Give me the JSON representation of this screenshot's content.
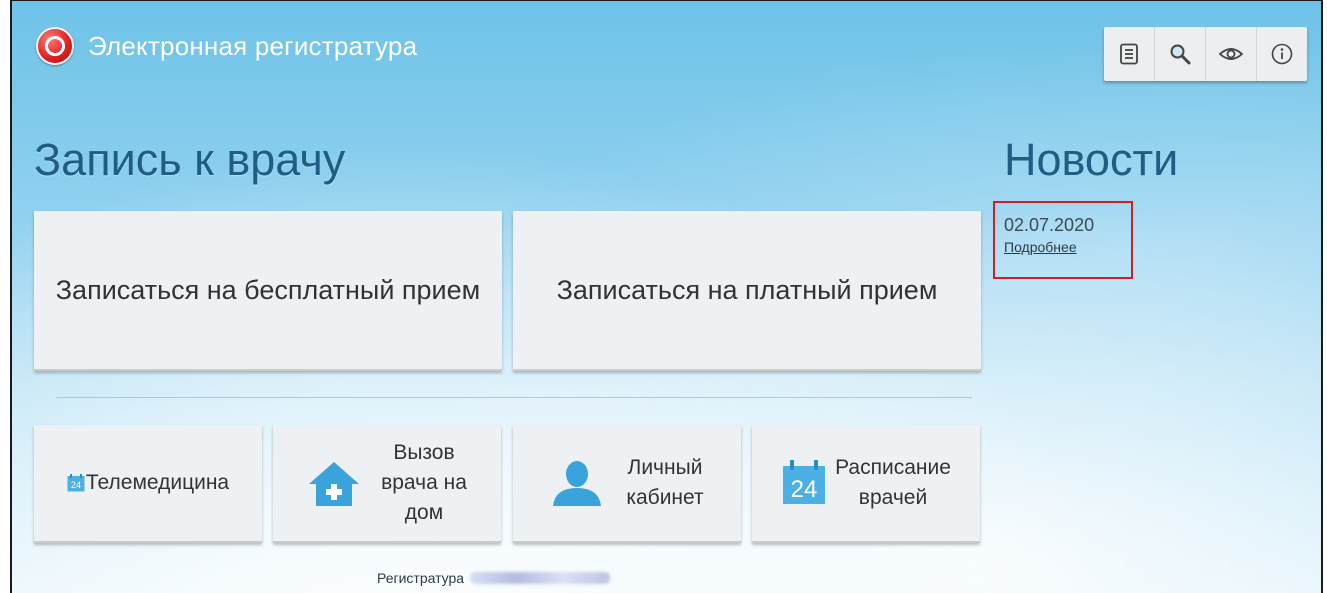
{
  "header": {
    "title": "Электронная регистратура",
    "logo_icon": "registry-logo-icon",
    "toolbar": [
      {
        "name": "document-icon"
      },
      {
        "name": "search-icon"
      },
      {
        "name": "eye-icon"
      },
      {
        "name": "info-icon"
      }
    ]
  },
  "appointment": {
    "heading": "Запись к врачу",
    "free_button": "Записаться на бесплатный прием",
    "paid_button": "Записаться на платный прием"
  },
  "services": {
    "telemed": "Телемедицина",
    "home_visit_line1": "Вызов",
    "home_visit_line2": "врача на",
    "home_visit_line3": "дом",
    "cabinet_line1": "Личный",
    "cabinet_line2": "кабинет",
    "schedule_line1": "Расписание",
    "schedule_line2": "врачей",
    "calendar_day": "24",
    "calendar_small_day": "24"
  },
  "news": {
    "heading": "Новости",
    "date": "02.07.2020",
    "more_link": "Подробнее"
  },
  "footer": {
    "label": "Регистратура"
  },
  "colors": {
    "accent": "#1f5d83",
    "icon_blue": "#3aa3dc",
    "highlight_red": "#d21e1e"
  }
}
